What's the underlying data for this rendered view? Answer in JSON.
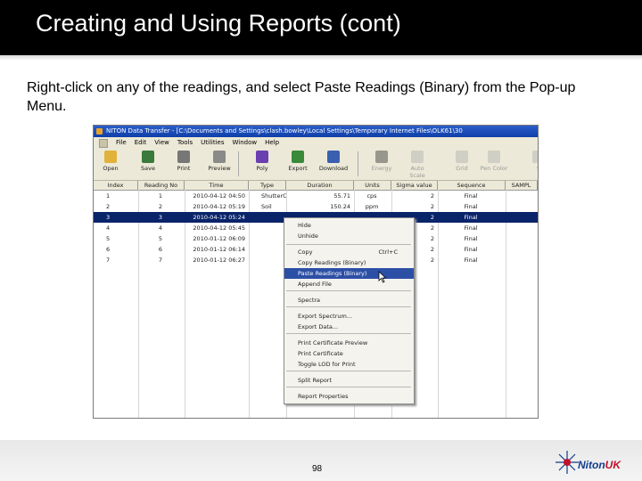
{
  "slide": {
    "title": "Creating and Using Reports (cont)",
    "instruction": "Right-click on any of the readings, and select Paste Readings (Binary) from the Pop-up Menu.",
    "page_number": "98",
    "logo_text_a": "Niton",
    "logo_text_b": "UK"
  },
  "app": {
    "title": "NITON Data Transfer - [C:\\Documents and Settings\\clash.bowley\\Local Settings\\Temporary Internet Files\\OLK61\\30",
    "menu": [
      "File",
      "Edit",
      "View",
      "Tools",
      "Utilities",
      "Window",
      "Help"
    ],
    "toolbar": [
      {
        "label": "Open",
        "icon": "open-folder-icon",
        "color": "#e0b23a",
        "dim": false
      },
      {
        "label": "Save",
        "icon": "save-disk-icon",
        "color": "#3a7a3a",
        "dim": false
      },
      {
        "label": "Print",
        "icon": "printer-icon",
        "color": "#777777",
        "dim": false
      },
      {
        "label": "Preview",
        "icon": "print-preview-icon",
        "color": "#8a8a8a",
        "dim": false
      },
      {
        "label": "Poly",
        "icon": "poly-icon",
        "color": "#6a3fb0",
        "dim": false
      },
      {
        "label": "Export",
        "icon": "export-icon",
        "color": "#3a8a3a",
        "dim": false
      },
      {
        "label": "Download",
        "icon": "download-icon",
        "color": "#3a5fb0",
        "dim": false
      },
      {
        "label": "Energy",
        "icon": "energy-chart-icon",
        "color": "#333333",
        "dim": true
      },
      {
        "label": "Auto Scale",
        "icon": "auto-scale-icon",
        "color": "#b0b0b0",
        "dim": true
      },
      {
        "label": "Grid",
        "icon": "grid-icon",
        "color": "#b0b0b0",
        "dim": true
      },
      {
        "label": "Pen Color",
        "icon": "pen-color-icon",
        "color": "#b0b0b0",
        "dim": true
      },
      {
        "label": "S",
        "icon": "settings-icon",
        "color": "#b0b0b0",
        "dim": true
      }
    ],
    "columns": [
      "Index",
      "Reading No",
      "Time",
      "Type",
      "Duration",
      "Units",
      "Sigma value",
      "Sequence",
      "SAMPL"
    ],
    "rows": [
      {
        "index": "1",
        "reading": "1",
        "time": "2010-04-12 04:50",
        "type": "ShutterCal",
        "duration": "55.71",
        "units": "cps",
        "sigma": "2",
        "sequence": "Final"
      },
      {
        "index": "2",
        "reading": "2",
        "time": "2010-04-12 05:19",
        "type": "Soil",
        "duration": "150.24",
        "units": "ppm",
        "sigma": "2",
        "sequence": "Final"
      },
      {
        "index": "3",
        "reading": "3",
        "time": "2010-04-12 05:24",
        "type": "",
        "duration": "",
        "units": "",
        "sigma": "2",
        "sequence": "Final"
      },
      {
        "index": "4",
        "reading": "4",
        "time": "2010-04-12 05:45",
        "type": "",
        "duration": "",
        "units": "",
        "sigma": "2",
        "sequence": "Final"
      },
      {
        "index": "5",
        "reading": "5",
        "time": "2010-01-12 06:09",
        "type": "",
        "duration": "",
        "units": "",
        "sigma": "2",
        "sequence": "Final"
      },
      {
        "index": "6",
        "reading": "6",
        "time": "2010-01-12 06:14",
        "type": "",
        "duration": "",
        "units": "",
        "sigma": "2",
        "sequence": "Final"
      },
      {
        "index": "7",
        "reading": "7",
        "time": "2010-01-12 06:27",
        "type": "",
        "duration": "",
        "units": "",
        "sigma": "2",
        "sequence": "Final"
      }
    ],
    "context_menu": [
      {
        "label": "Hide",
        "shortcut": ""
      },
      {
        "label": "Unhide",
        "shortcut": ""
      },
      {
        "label": "Copy",
        "shortcut": "Ctrl+C"
      },
      {
        "label": "Copy Readings (Binary)",
        "shortcut": ""
      },
      {
        "label": "Paste Readings (Binary)",
        "shortcut": "",
        "highlighted": true
      },
      {
        "label": "Append File",
        "shortcut": ""
      },
      {
        "label": "Spectra",
        "shortcut": ""
      },
      {
        "label": "Export Spectrum...",
        "shortcut": ""
      },
      {
        "label": "Export Data...",
        "shortcut": ""
      },
      {
        "label": "Print Certificate Preview",
        "shortcut": ""
      },
      {
        "label": "Print Certificate",
        "shortcut": ""
      },
      {
        "label": "Toggle LOD for Print",
        "shortcut": ""
      },
      {
        "label": "Split Report",
        "shortcut": ""
      },
      {
        "label": "Report Properties",
        "shortcut": ""
      }
    ]
  }
}
